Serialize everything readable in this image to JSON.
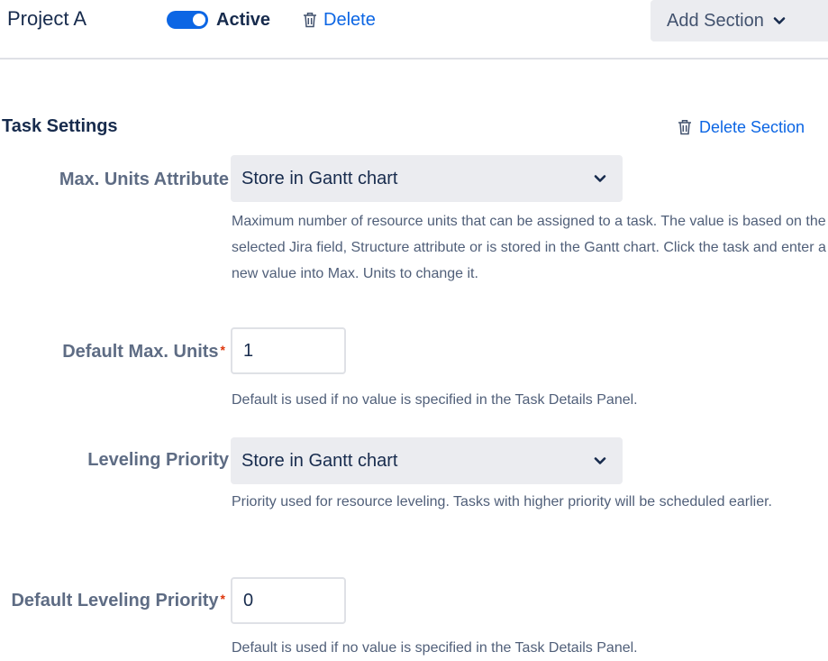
{
  "header": {
    "project_name": "Project A",
    "status_label": "Active",
    "status_active": true,
    "delete_label": "Delete",
    "add_section_label": "Add Section"
  },
  "section": {
    "title": "Task Settings",
    "delete_label": "Delete Section",
    "fields": [
      {
        "label": "Max. Units Attribute",
        "required": false,
        "type": "select",
        "value": "Store in Gantt chart",
        "help": "Maximum number of resource units that can be assigned to a task. The value is based on the selected Jira field, Structure attribute or is stored in the Gantt chart. Click the task and enter a new value into Max. Units to change it."
      },
      {
        "label": "Default Max. Units",
        "required": true,
        "type": "text",
        "value": "1",
        "help": "Default is used if no value is specified in the Task Details Panel."
      },
      {
        "label": "Leveling Priority",
        "required": false,
        "type": "select",
        "value": "Store in Gantt chart",
        "help": "Priority used for resource leveling. Tasks with higher priority will be scheduled earlier."
      },
      {
        "label": "Default Leveling Priority",
        "required": true,
        "type": "text",
        "value": "0",
        "help": "Default is used if no value is specified in the Task Details Panel."
      }
    ]
  },
  "required_marker": "*",
  "colors": {
    "link": "#0c66e4",
    "toggle_on": "#0c66e4",
    "required": "#de350b",
    "field_bg": "#ebecf0",
    "label": "#5e6c84",
    "help_text": "#505f79"
  },
  "icons": [
    "trash-icon",
    "chevron-down-icon"
  ]
}
